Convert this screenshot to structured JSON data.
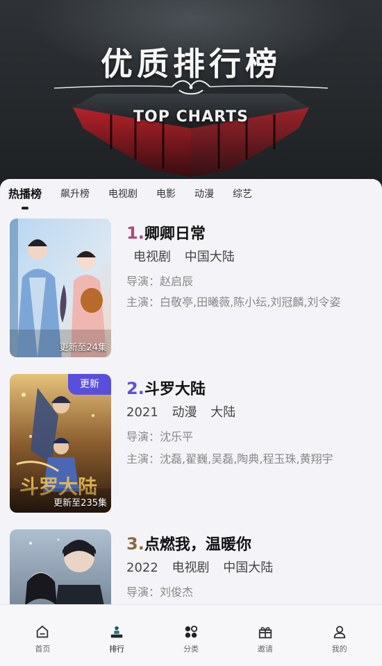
{
  "hero": {
    "title": "优质排行榜",
    "subtitle": "TOP CHARTS"
  },
  "tabs": [
    {
      "label": "热播榜",
      "active": true
    },
    {
      "label": "飙升榜",
      "active": false
    },
    {
      "label": "电视剧",
      "active": false
    },
    {
      "label": "电影",
      "active": false
    },
    {
      "label": "动漫",
      "active": false
    },
    {
      "label": "综艺",
      "active": false
    }
  ],
  "items": [
    {
      "rank": "1.",
      "rank_color": "#b7447a",
      "title": "卿卿日常",
      "year": "",
      "type": "电视剧",
      "region": "中国大陆",
      "director_label": "导演：",
      "director": "赵启辰",
      "cast_label": "主演：",
      "cast": "白敬亭,田曦薇,陈小纭,刘冠麟,刘令姿",
      "update": "更新至24集",
      "badge": ""
    },
    {
      "rank": "2.",
      "rank_color": "#5b52d6",
      "title": "斗罗大陆",
      "year": "2021",
      "type": "动漫",
      "region": "大陆",
      "director_label": "导演：",
      "director": "沈乐平",
      "cast_label": "主演：",
      "cast": "沈磊,翟巍,吴磊,陶典,程玉珠,黄翔宇",
      "update": "更新至235集",
      "badge": "更新"
    },
    {
      "rank": "3.",
      "rank_color": "#8a6a3e",
      "title": "点燃我，温暖你",
      "year": "2022",
      "type": "电视剧",
      "region": "中国大陆",
      "director_label": "导演：",
      "director": "刘俊杰",
      "cast_label": "",
      "cast": "",
      "update": "",
      "badge": ""
    }
  ],
  "nav": [
    {
      "label": "首页",
      "icon": "home-icon"
    },
    {
      "label": "排行",
      "icon": "ranking-icon",
      "active": true
    },
    {
      "label": "分类",
      "icon": "category-icon"
    },
    {
      "label": "邀请",
      "icon": "gift-icon"
    },
    {
      "label": "我的",
      "icon": "profile-icon"
    }
  ]
}
